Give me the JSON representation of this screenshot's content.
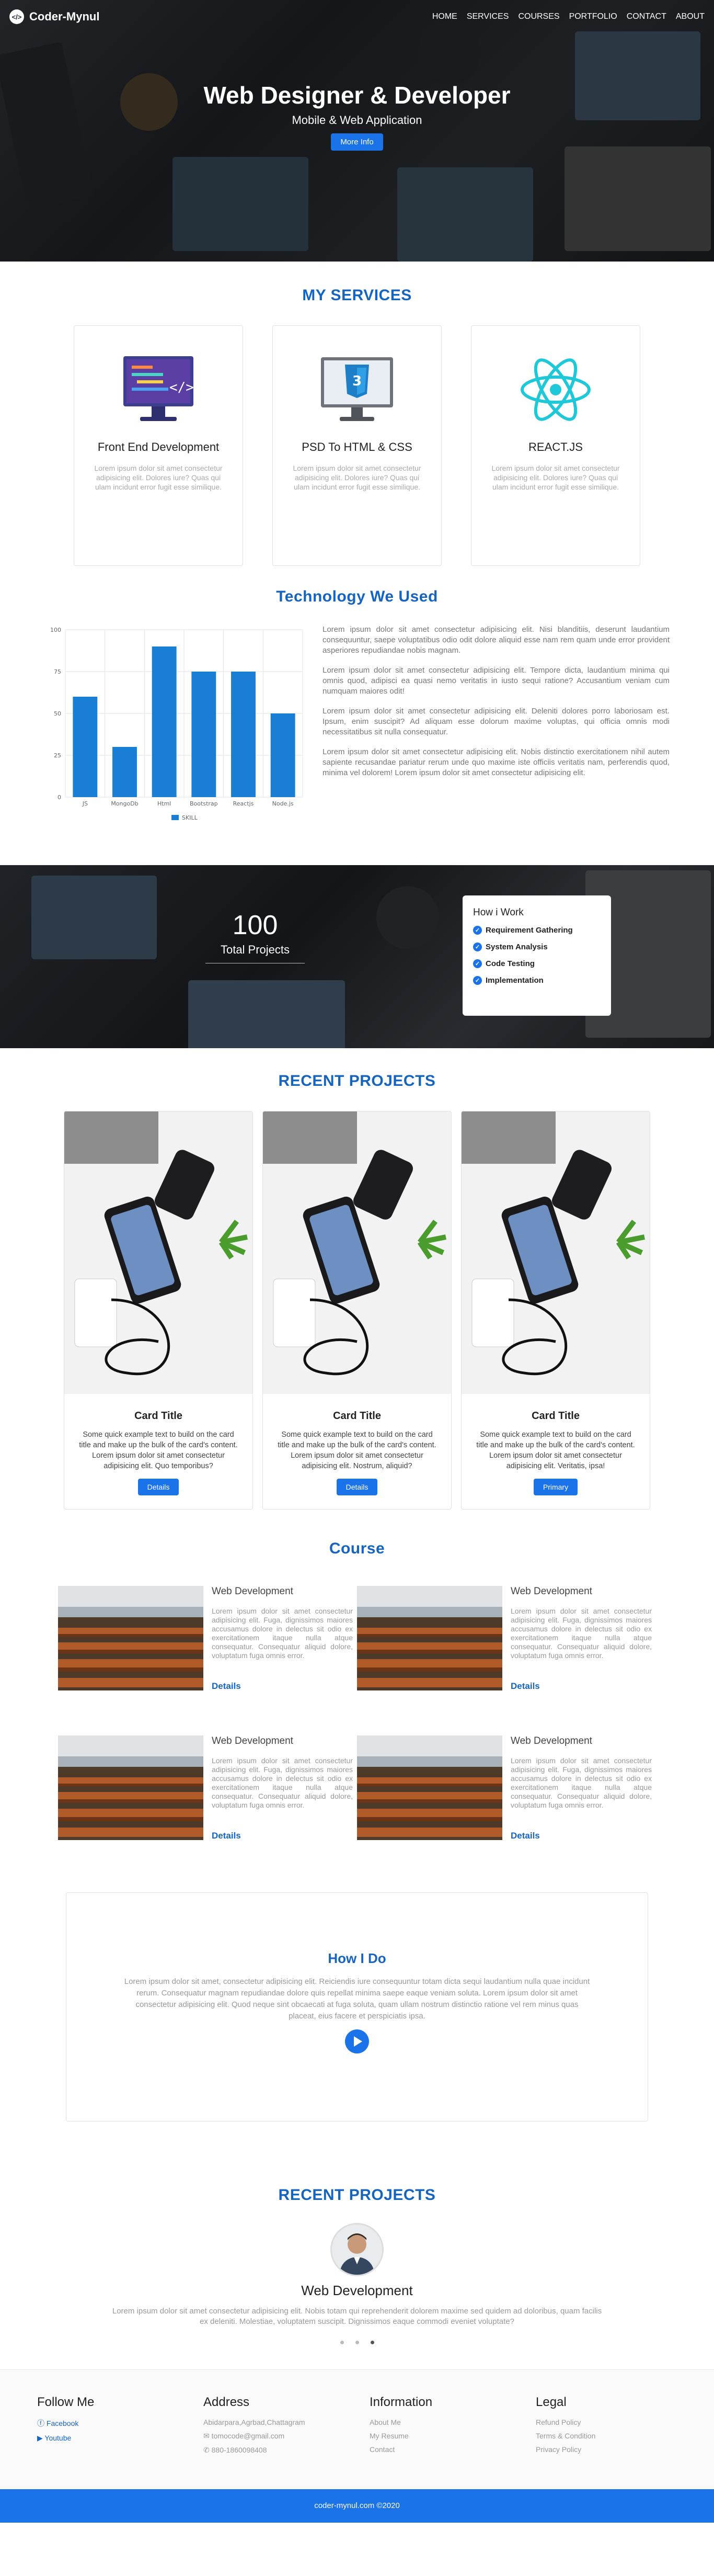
{
  "brand": {
    "name": "Coder-Mynul",
    "logo_text": "</>"
  },
  "nav": [
    "HOME",
    "SERVICES",
    "COURSES",
    "PORTFOLIO",
    "CONTACT",
    "ABOUT"
  ],
  "hero": {
    "title": "Web Designer & Developer",
    "subtitle": "Mobile & Web Application",
    "button": "More Info"
  },
  "services": {
    "title": "MY SERVICES",
    "cards": [
      {
        "icon": "monitor-code-icon",
        "title": "Front End Development",
        "text": "Lorem ipsum dolor sit amet consectetur adipisicing elit. Dolores iure? Quas qui ulam incidunt error fugit esse similique."
      },
      {
        "icon": "css3-monitor-icon",
        "title": "PSD To HTML & CSS",
        "text": "Lorem ipsum dolor sit amet consectetur adipisicing elit. Dolores iure? Quas qui ulam incidunt error fugit esse similique."
      },
      {
        "icon": "react-atom-icon",
        "title": "REACT.JS",
        "text": "Lorem ipsum dolor sit amet consectetur adipisicing elit. Dolores iure? Quas qui ulam incidunt error fugit esse similique."
      }
    ]
  },
  "technology": {
    "title": "Technology We Used",
    "paragraphs": [
      "Lorem ipsum dolor sit amet consectetur adipisicing elit. Nisi blanditiis, deserunt laudantium consequuntur, saepe voluptatibus odio odit dolore aliquid esse nam rem quam unde error provident asperiores repudiandae nobis magnam.",
      "Lorem ipsum dolor sit amet consectetur adipisicing elit. Tempore dicta, laudantium minima qui omnis quod, adipisci ea quasi nemo veritatis in iusto sequi ratione? Accusantium veniam cum numquam maiores odit!",
      "Lorem ipsum dolor sit amet consectetur adipisicing elit. Deleniti dolores porro laboriosam est. Ipsum, enim suscipit? Ad aliquam esse dolorum maxime voluptas, qui officia omnis modi necessitatibus sit nulla consequatur.",
      "Lorem ipsum dolor sit amet consectetur adipisicing elit. Nobis distinctio exercitationem nihil autem sapiente recusandae pariatur rerum unde quo maxime iste officiis veritatis nam, perferendis quod, minima vel dolorem! Lorem ipsum dolor sit amet consectetur adipisicing elit."
    ]
  },
  "chart_data": {
    "type": "bar",
    "categories": [
      "JS",
      "MongoDb",
      "Html",
      "Bootstrap",
      "Reactjs",
      "Node.js"
    ],
    "series": [
      {
        "name": "SKILL",
        "values": [
          60,
          30,
          90,
          75,
          75,
          50
        ],
        "color": "#1a7fd4"
      }
    ],
    "ylim": [
      0,
      100
    ],
    "yticks": [
      0,
      25,
      50,
      75,
      100
    ],
    "grid": true,
    "legend": "bottom"
  },
  "stats": {
    "number": "100",
    "label": "Total Projects"
  },
  "how_work": {
    "title": "How i Work",
    "items": [
      "Requirement Gathering",
      "System Analysis",
      "Code Testing",
      "Implementation"
    ]
  },
  "projects": {
    "title": "RECENT PROJECTS",
    "cards": [
      {
        "title": "Card Title",
        "text": "Some quick example text to build on the card title and make up the bulk of the card's content. Lorem ipsum dolor sit amet consectetur adipisicing elit. Quo temporibus?",
        "button": "Details"
      },
      {
        "title": "Card Title",
        "text": "Some quick example text to build on the card title and make up the bulk of the card's content. Lorem ipsum dolor sit amet consectetur adipisicing elit. Nostrum, aliquid?",
        "button": "Details"
      },
      {
        "title": "Card Title",
        "text": "Some quick example text to build on the card title and make up the bulk of the card's content. Lorem ipsum dolor sit amet consectetur adipisicing elit. Veritatis, ipsa!",
        "button": "Primary"
      }
    ]
  },
  "course": {
    "title": "Course",
    "items": [
      {
        "title": "Web Development",
        "text": "Lorem ipsum dolor sit amet consectetur adipisicing elit. Fuga, dignissimos maiores accusamus dolore in delectus sit odio ex exercitationem itaque nulla atque consequatur. Consequatur aliquid dolore, voluptatum fuga omnis error.",
        "link": "Details"
      },
      {
        "title": "Web Development",
        "text": "Lorem ipsum dolor sit amet consectetur adipisicing elit. Fuga, dignissimos maiores accusamus dolore in delectus sit odio ex exercitationem itaque nulla atque consequatur. Consequatur aliquid dolore, voluptatum fuga omnis error.",
        "link": "Details"
      },
      {
        "title": "Web Development",
        "text": "Lorem ipsum dolor sit amet consectetur adipisicing elit. Fuga, dignissimos maiores accusamus dolore in delectus sit odio ex exercitationem itaque nulla atque consequatur. Consequatur aliquid dolore, voluptatum fuga omnis error.",
        "link": "Details"
      },
      {
        "title": "Web Development",
        "text": "Lorem ipsum dolor sit amet consectetur adipisicing elit. Fuga, dignissimos maiores accusamus dolore in delectus sit odio ex exercitationem itaque nulla atque consequatur. Consequatur aliquid dolore, voluptatum fuga omnis error.",
        "link": "Details"
      }
    ]
  },
  "how_i_do": {
    "title": "How I Do",
    "text": "Lorem ipsum dolor sit amet, consectetur adipisicing elit. Reiciendis iure consequuntur totam dicta sequi laudantium nulla quae incidunt rerum. Consequatur magnam repudiandae dolore quis repellat minima saepe eaque veniam soluta. Lorem ipsum dolor sit amet consectetur adipisicing elit. Quod neque sint obcaecati at fuga soluta, quam ullam nostrum distinctio ratione vel rem minus quas placeat, eius facere et perspiciatis ipsa."
  },
  "testimonial": {
    "title": "RECENT PROJECTS",
    "name": "Web Development",
    "text": "Lorem ipsum dolor sit amet consectetur adipisicing elit. Nobis totam qui reprehenderit dolorem maxime sed quidem ad doloribus, quam facilis ex deleniti. Molestiae, voluptatem suscipit. Dignissimos eaque commodi eveniet voluptate?"
  },
  "footer": {
    "follow": {
      "title": "Follow Me",
      "links": [
        "Facebook",
        "Youtube"
      ]
    },
    "address": {
      "title": "Address",
      "location": "Abidarpara,Agrbad,Chattagram",
      "email": "tomocode@gmail.com",
      "phone": "880-1860098408"
    },
    "information": {
      "title": "Information",
      "links": [
        "About Me",
        "My Resume",
        "Contact"
      ]
    },
    "legal": {
      "title": "Legal",
      "links": [
        "Refund Policy",
        "Terms & Condition",
        "Privacy Policy"
      ]
    },
    "copyright": "coder-mynul.com ©2020"
  },
  "colors": {
    "accent": "#1a73e8",
    "heading": "#1565c0"
  }
}
